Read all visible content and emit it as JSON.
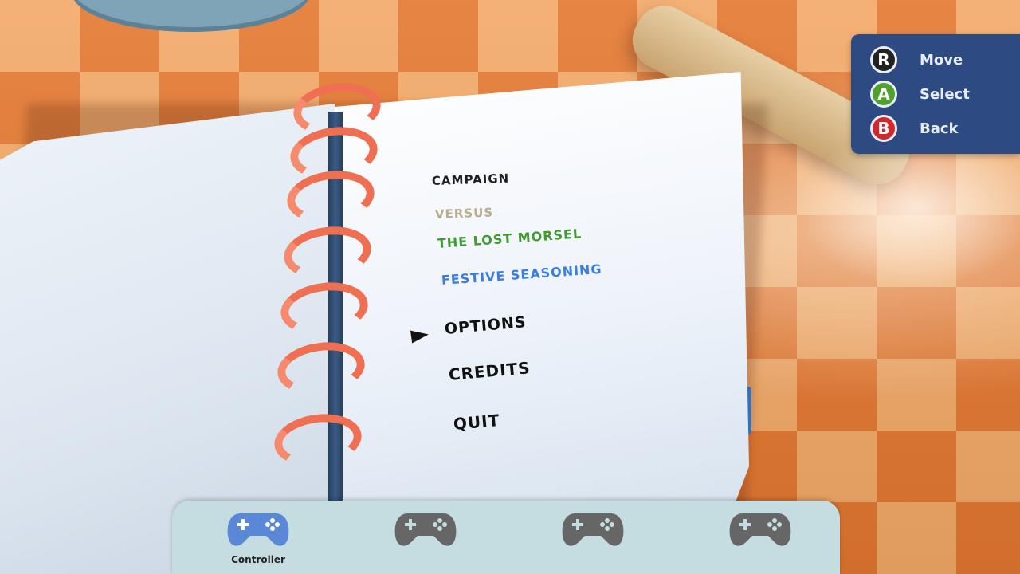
{
  "menu": {
    "items": [
      {
        "label": "CAMPAIGN",
        "color": "#1f1f1f"
      },
      {
        "label": "VERSUS",
        "color": "#b9ad8c"
      },
      {
        "label": "THE LOST MORSEL",
        "color": "#3f9a2f"
      },
      {
        "label": "FESTIVE SEASONING",
        "color": "#3a7fe0"
      },
      {
        "label": "OPTIONS",
        "color": "#111111"
      },
      {
        "label": "CREDITS",
        "color": "#111111"
      },
      {
        "label": "QUIT",
        "color": "#111111"
      }
    ],
    "selected": "OPTIONS"
  },
  "hints": [
    {
      "button": "R",
      "label": "Move",
      "color": "#222222"
    },
    {
      "button": "A",
      "label": "Select",
      "color": "#4fa02c"
    },
    {
      "button": "B",
      "label": "Back",
      "color": "#d0282d"
    }
  ],
  "controllers": [
    {
      "label": "Controller",
      "active": true,
      "color": "#5b88d6"
    },
    {
      "label": "",
      "active": false,
      "color": "#666666"
    },
    {
      "label": "",
      "active": false,
      "color": "#666666"
    },
    {
      "label": "",
      "active": false,
      "color": "#666666"
    }
  ]
}
